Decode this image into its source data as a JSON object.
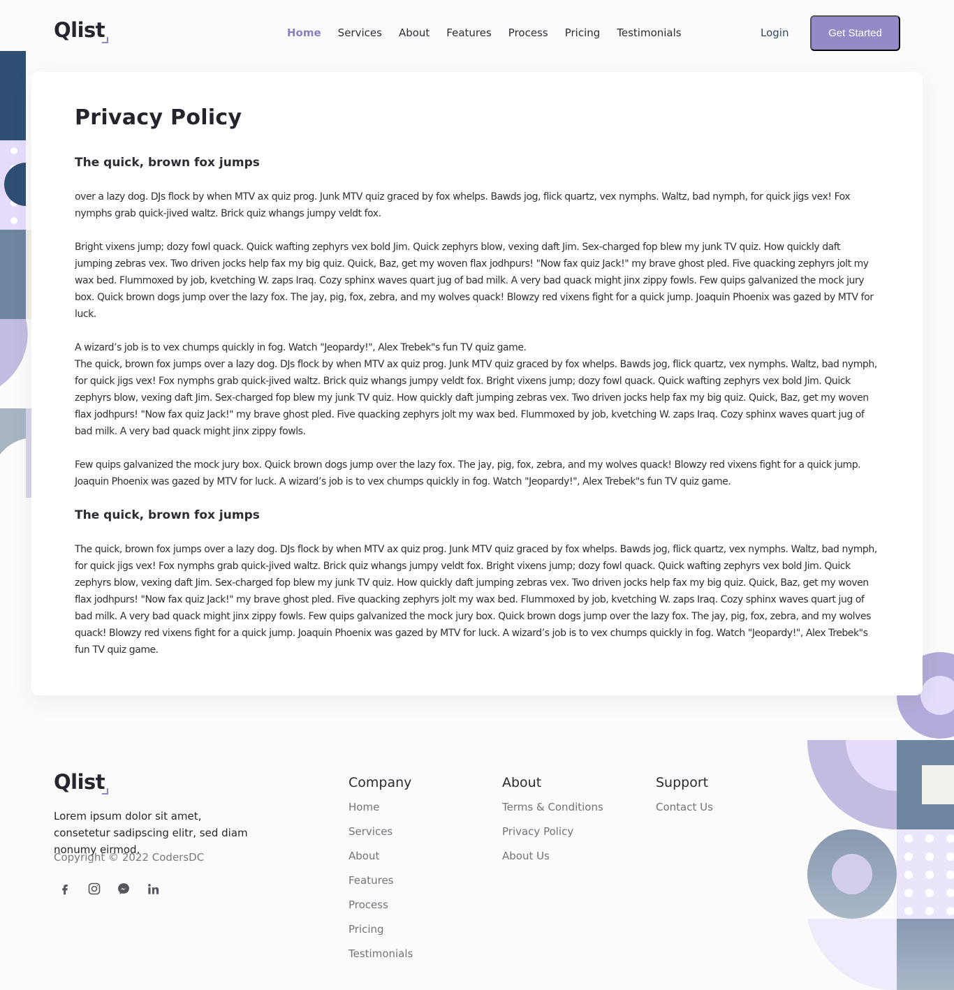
{
  "brand": {
    "name": "Qlist"
  },
  "nav": {
    "items": [
      "Home",
      "Services",
      "About",
      "Features",
      "Process",
      "Pricing",
      "Testimonials"
    ],
    "active": "Home",
    "login_label": "Login",
    "cta_label": "Get Started"
  },
  "page": {
    "title": "Privacy Policy",
    "sections": [
      {
        "heading": "The quick, brown fox jumps",
        "paragraphs": [
          "over a lazy dog. DJs flock by when MTV ax quiz prog. Junk MTV quiz graced by fox whelps. Bawds jog, flick quartz, vex nymphs. Waltz, bad nymph, for quick jigs vex! Fox nymphs grab quick-jived waltz. Brick quiz whangs jumpy veldt fox.",
          " Bright vixens jump; dozy fowl quack. Quick wafting zephyrs vex bold Jim. Quick zephyrs blow, vexing daft Jim. Sex-charged fop blew my junk TV quiz. How quickly daft jumping zebras vex. Two driven jocks help fax my big quiz. Quick, Baz, get my woven flax jodhpurs! \"Now fax quiz Jack!\" my brave ghost pled. Five quacking zephyrs jolt my wax bed. Flummoxed by job, kvetching W. zaps Iraq. Cozy sphinx waves quart jug of bad milk. A very bad quack might jinx zippy fowls. Few quips galvanized the mock jury box. Quick brown dogs jump over the lazy fox. The jay, pig, fox, zebra, and my wolves quack! Blowzy red vixens fight for a quick jump. Joaquin Phoenix was gazed by MTV for luck.",
          "A wizard’s job is to vex chumps quickly in fog. Watch \"Jeopardy!\", Alex Trebek\"s fun TV quiz game.",
          "The quick, brown fox jumps over a lazy dog. DJs flock by when MTV ax quiz prog. Junk MTV quiz graced by fox whelps. Bawds jog, flick quartz, vex nymphs. Waltz, bad nymph, for quick jigs vex! Fox nymphs grab quick-jived waltz. Brick quiz whangs jumpy veldt fox. Bright vixens jump; dozy fowl quack. Quick wafting zephyrs vex bold Jim. Quick zephyrs blow, vexing daft Jim. Sex-charged fop blew my junk TV quiz. How quickly daft jumping zebras vex. Two driven jocks help fax my big quiz. Quick, Baz, get my woven flax jodhpurs! \"Now fax quiz Jack!\" my brave ghost pled. Five quacking zephyrs jolt my wax bed. Flummoxed by job, kvetching W. zaps Iraq. Cozy sphinx waves quart jug of bad milk. A very bad quack might jinx zippy fowls.",
          " Few quips galvanized the mock jury box. Quick brown dogs jump over the lazy fox. The jay, pig, fox, zebra, and my wolves quack! Blowzy red vixens fight for a quick jump. Joaquin Phoenix was gazed by MTV for luck. A wizard’s job is to vex chumps quickly in fog. Watch \"Jeopardy!\", Alex Trebek\"s fun TV quiz game."
        ]
      },
      {
        "heading": "The quick, brown fox jumps",
        "paragraphs": [
          "The quick, brown fox jumps over a lazy dog. DJs flock by when MTV ax quiz prog. Junk MTV quiz graced by fox whelps. Bawds jog, flick quartz, vex nymphs. Waltz, bad nymph, for quick jigs vex! Fox nymphs grab quick-jived waltz. Brick quiz whangs jumpy veldt fox. Bright vixens jump; dozy fowl quack. Quick wafting zephyrs vex bold Jim. Quick zephyrs blow, vexing daft Jim. Sex-charged fop blew my junk TV quiz. How quickly daft jumping zebras vex. Two driven jocks help fax my big quiz. Quick, Baz, get my woven flax jodhpurs! \"Now fax quiz Jack!\" my brave ghost pled. Five quacking zephyrs jolt my wax bed. Flummoxed by job, kvetching W. zaps Iraq. Cozy sphinx waves quart jug of bad milk. A very bad quack might jinx zippy fowls. Few quips galvanized the mock jury box. Quick brown dogs jump over the lazy fox. The jay, pig, fox, zebra, and my wolves quack! Blowzy red vixens fight for a quick jump. Joaquin Phoenix was gazed by MTV for luck. A wizard’s job is to vex chumps quickly in fog. Watch \"Jeopardy!\", Alex Trebek\"s fun TV quiz game."
        ]
      }
    ]
  },
  "footer": {
    "description": "Lorem ipsum dolor sit amet, consetetur sadipscing elitr, sed diam nonumy eirmod.",
    "copyright": "Copyright © 2022 CodersDC",
    "socials": [
      "facebook-icon",
      "instagram-icon",
      "messenger-icon",
      "linkedin-icon"
    ],
    "columns": [
      {
        "title": "Company",
        "links": [
          "Home",
          "Services",
          "About",
          "Features",
          "Process",
          "Pricing",
          "Testimonials"
        ]
      },
      {
        "title": "About",
        "links": [
          "Terms & Conditions",
          "Privacy Policy",
          "About Us"
        ]
      },
      {
        "title": "Support",
        "links": [
          "Contact Us"
        ]
      }
    ]
  },
  "colors": {
    "accent": "#958ac8",
    "nav_active": "#8a80c0",
    "login": "#2f4668",
    "deco_navy": "#2e4f73",
    "deco_slate": "#6f86a1",
    "deco_lavender": "#c3bce0",
    "deco_lilac": "#e4dcfa"
  }
}
